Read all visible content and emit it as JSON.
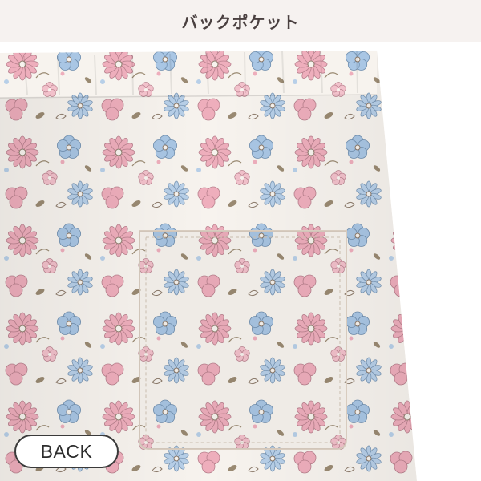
{
  "header": {
    "title": "バックポケット"
  },
  "photo": {
    "subject": "floral-print-pants-back-pocket",
    "colors": {
      "fabric": "#f7f3ee",
      "pink": "#eeaebc",
      "blue": "#a9c6e4",
      "outline": "#8c7a6a",
      "leaf": "#9a8a72"
    }
  },
  "badge": {
    "label": "BACK"
  }
}
